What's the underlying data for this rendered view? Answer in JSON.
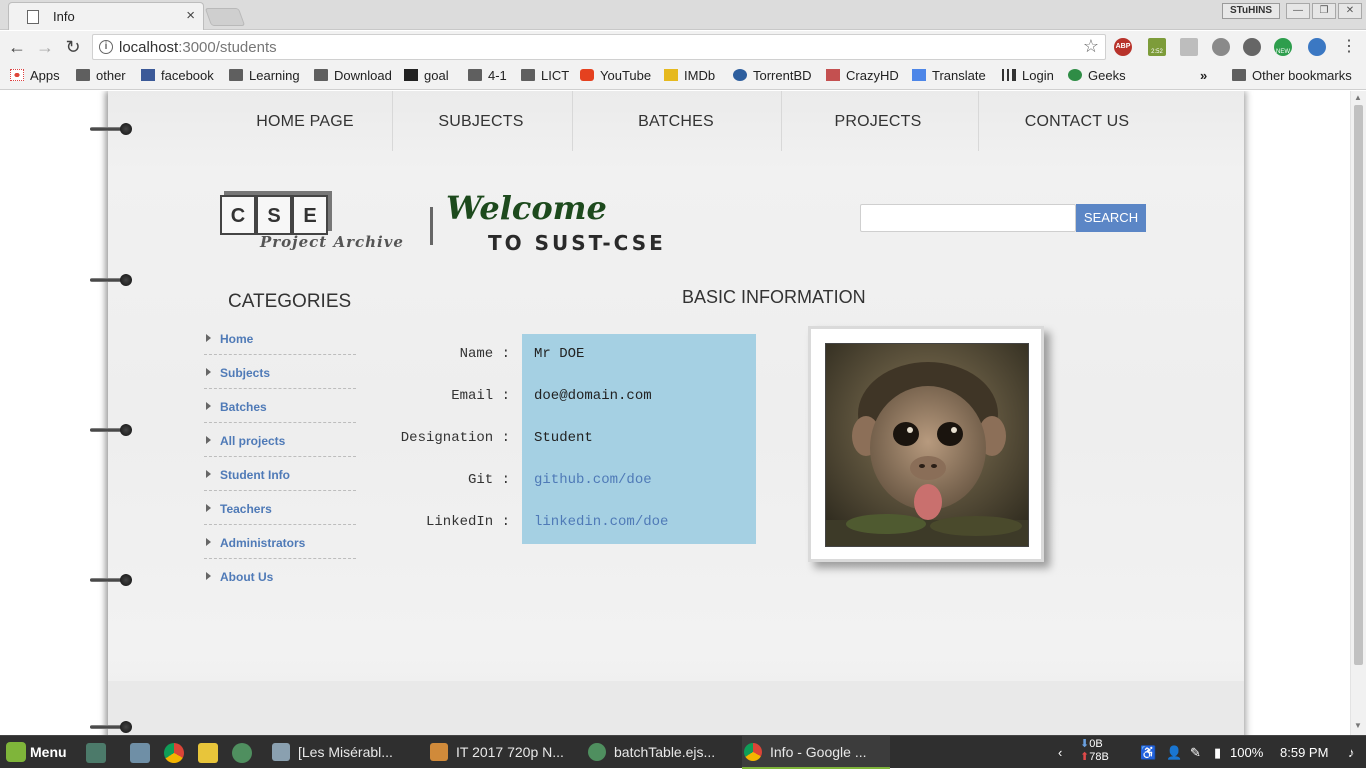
{
  "browser": {
    "tab_title": "Info",
    "tab_close": "×",
    "profile_badge": "STuHINS",
    "url_host": "localhost",
    "url_path": ":3000/students",
    "bookmarks": [
      "Apps",
      "other",
      "facebook",
      "Learning",
      "Download",
      "goal",
      "4-1",
      "LICT",
      "YouTube",
      "IMDb",
      "TorrentBD",
      "CrazyHD",
      "Translate",
      "Login",
      "Geeks"
    ],
    "bookmarks_overflow": "»",
    "other_bookmarks": "Other bookmarks",
    "extension_badges": {
      "abp": "ABP",
      "count": "2:52",
      "new": "NEW"
    }
  },
  "site": {
    "nav": [
      "HOME PAGE",
      "SUBJECTS",
      "BATCHES",
      "PROJECTS",
      "CONTACT US"
    ],
    "logo_letters": [
      "C",
      "S",
      "E"
    ],
    "logo_subtitle": "Project Archive",
    "welcome_line1": "Welcome",
    "welcome_line2": "TO SUST-CSE",
    "search": {
      "placeholder": "",
      "button": "SEARCH"
    },
    "categories_title": "CATEGORIES",
    "categories": [
      "Home",
      "Subjects",
      "Batches",
      "All projects",
      "Student Info",
      "Teachers",
      "Administrators",
      "About Us"
    ],
    "info_title": "BASIC INFORMATION",
    "fields": [
      {
        "label": "Name :",
        "value": "Mr DOE",
        "link": false
      },
      {
        "label": "Email :",
        "value": "doe@domain.com",
        "link": false
      },
      {
        "label": "Designation :",
        "value": "Student",
        "link": false
      },
      {
        "label": "Git :",
        "value": "github.com/doe",
        "link": true
      },
      {
        "label": "LinkedIn :",
        "value": "linkedin.com/doe",
        "link": true
      }
    ],
    "colors": {
      "link": "#4f7ab7",
      "panel": "#a5d0e3",
      "search_button": "#5b86c6",
      "welcome": "#1d4a1d"
    }
  },
  "taskbar": {
    "menu": "Menu",
    "tasks": [
      "[Les Misérabl...",
      "IT 2017 720p N...",
      "batchTable.ejs...",
      "Info - Google ..."
    ],
    "net_down": "0B",
    "net_up": "78B",
    "battery": "100%",
    "time": "8:59 PM"
  }
}
